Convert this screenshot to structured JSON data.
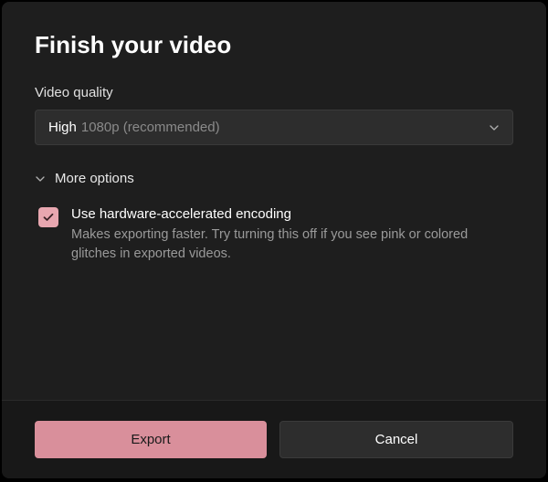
{
  "dialog": {
    "title": "Finish your video",
    "quality": {
      "label": "Video quality",
      "selected_primary": "High",
      "selected_secondary": "1080p (recommended)"
    },
    "more_options": {
      "label": "More options",
      "hw_encoding": {
        "title": "Use hardware-accelerated encoding",
        "description": "Makes exporting faster. Try turning this off if you see pink or colored glitches in exported videos.",
        "checked": true
      }
    },
    "buttons": {
      "export": "Export",
      "cancel": "Cancel"
    }
  },
  "colors": {
    "accent": "#d98f9b",
    "checkbox": "#e8a7b0"
  }
}
